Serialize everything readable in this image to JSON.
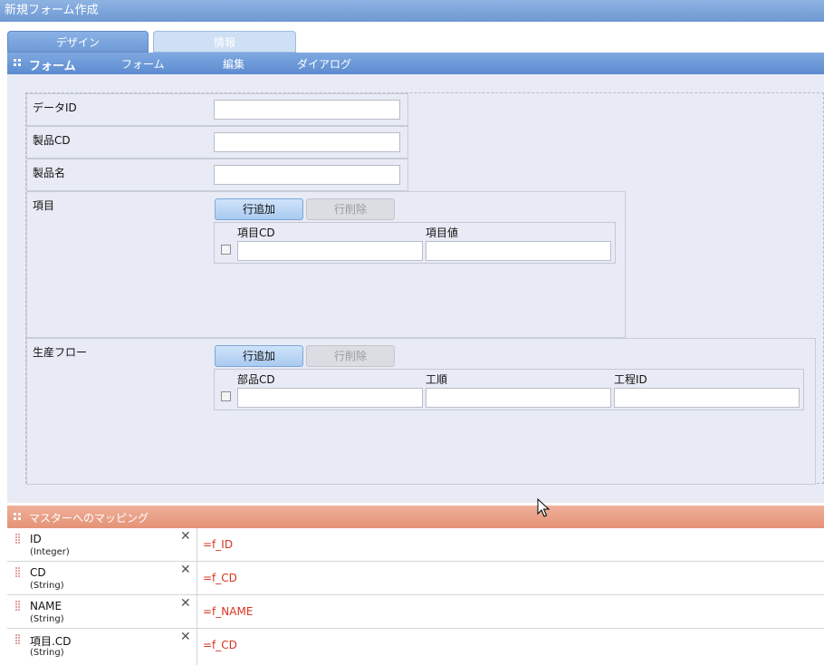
{
  "window": {
    "title": "新規フォーム作成"
  },
  "tabs": [
    {
      "label": "デザイン",
      "active": true
    },
    {
      "label": "情報",
      "active": false
    }
  ],
  "menubar": {
    "title": "フォーム",
    "items": [
      "フォーム",
      "編集",
      "ダイアログ"
    ]
  },
  "form": {
    "fields": [
      {
        "label": "データID",
        "value": ""
      },
      {
        "label": "製品CD",
        "value": ""
      },
      {
        "label": "製品名",
        "value": ""
      }
    ],
    "tables": [
      {
        "label": "項目",
        "add_button": "行追加",
        "delete_button": "行削除",
        "columns": [
          "項目CD",
          "項目値"
        ]
      },
      {
        "label": "生産フロー",
        "add_button": "行追加",
        "delete_button": "行削除",
        "columns": [
          "部品CD",
          "工順",
          "工程ID"
        ]
      }
    ]
  },
  "mapping": {
    "title": "マスターへのマッピング",
    "rows": [
      {
        "name": "ID",
        "type": "(Integer)",
        "expr": "=f_ID"
      },
      {
        "name": "CD",
        "type": "(String)",
        "expr": "=f_CD"
      },
      {
        "name": "NAME",
        "type": "(String)",
        "expr": "=f_NAME"
      },
      {
        "name": "項目.CD",
        "type": "(String)",
        "expr": "=f_CD"
      }
    ]
  },
  "colors": {
    "titlebar": "#7ba3da",
    "mapping_header": "#e8a088",
    "expression_text": "#d8341e"
  }
}
